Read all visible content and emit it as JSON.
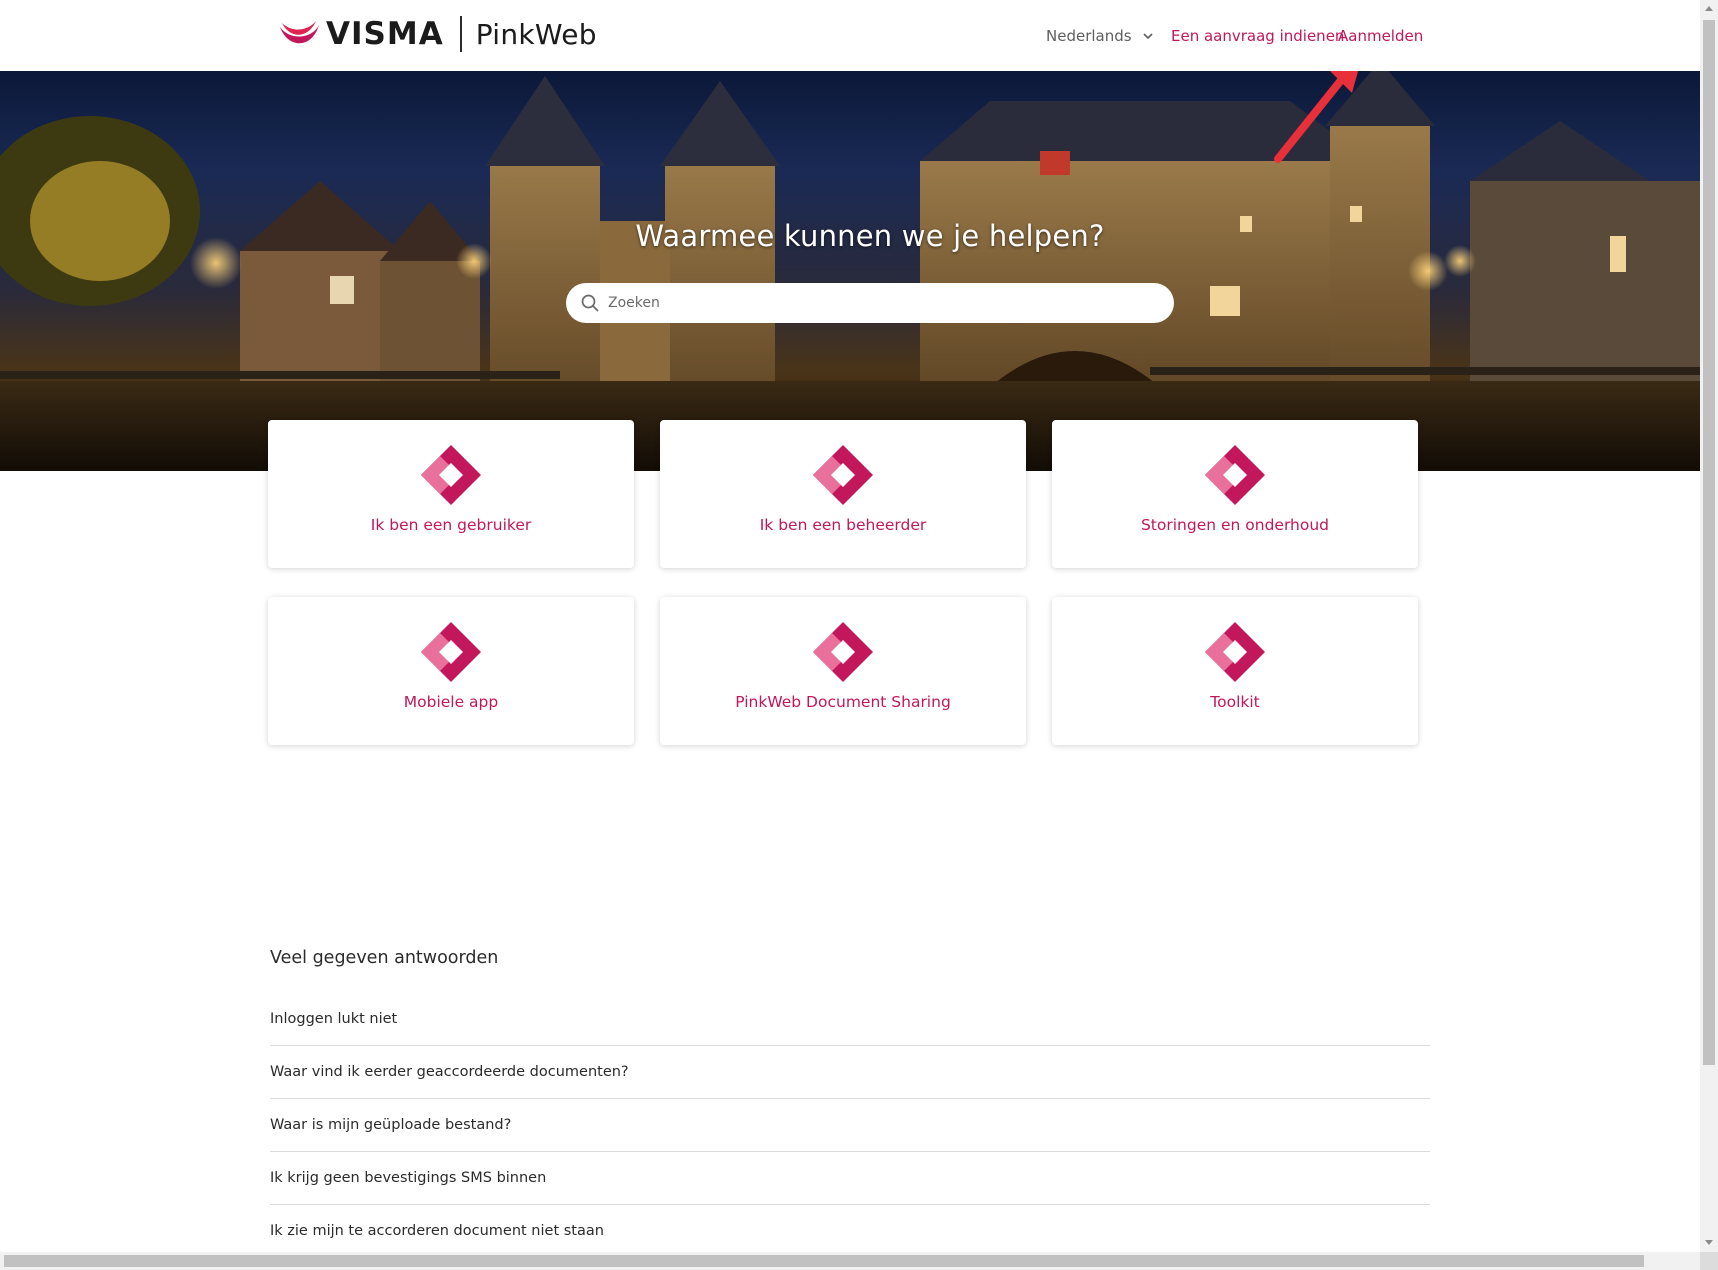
{
  "header": {
    "brand": "VISMA",
    "product": "PinkWeb",
    "language": "Nederlands",
    "request_link": "Een aanvraag indienen",
    "login_link": "Aanmelden"
  },
  "hero": {
    "title": "Waarmee kunnen we je helpen?",
    "search_placeholder": "Zoeken"
  },
  "cards": [
    {
      "label": "Ik ben een gebruiker"
    },
    {
      "label": "Ik ben een beheerder"
    },
    {
      "label": "Storingen en onderhoud"
    },
    {
      "label": "Mobiele app"
    },
    {
      "label": "PinkWeb Document Sharing"
    },
    {
      "label": "Toolkit"
    }
  ],
  "faq": {
    "title": "Veel gegeven antwoorden",
    "items": [
      "Inloggen lukt niet",
      "Waar vind ik eerder geaccordeerde documenten?",
      "Waar is mijn geüploade bestand?",
      "Ik krijg geen bevestigings SMS binnen",
      "Ik zie mijn te accorderen document niet staan"
    ]
  },
  "colors": {
    "accent": "#c2185b",
    "accent_light": "#e8709a",
    "annotation_arrow": "#e8303a"
  },
  "icons": {
    "brand": "visma-logo",
    "language_dropdown": "chevron-down-icon",
    "search": "search-icon",
    "card": "pinkweb-diamond-icon"
  }
}
